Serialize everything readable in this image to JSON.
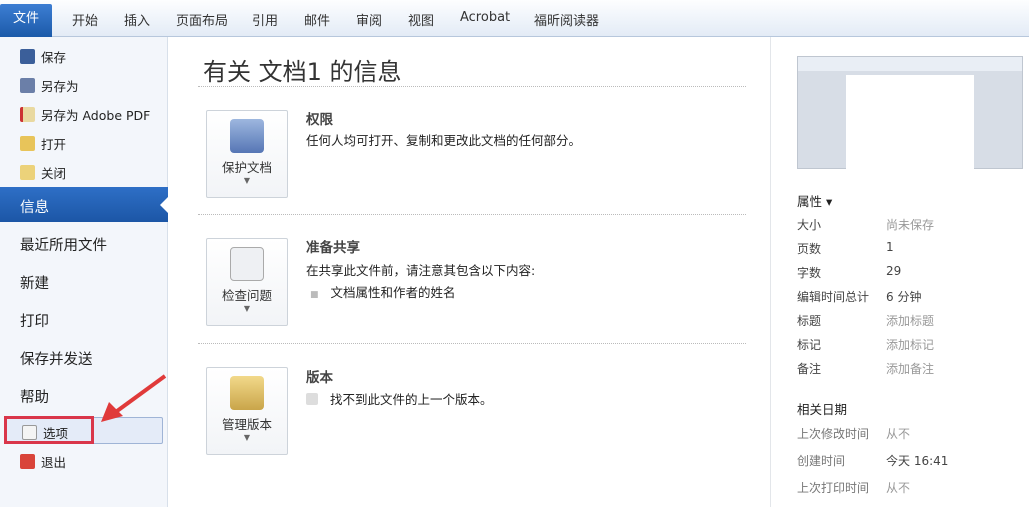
{
  "tabs": [
    "文件",
    "开始",
    "插入",
    "页面布局",
    "引用",
    "邮件",
    "审阅",
    "视图",
    "Acrobat",
    "福昕阅读器"
  ],
  "sidebar": {
    "small": [
      "保存",
      "另存为",
      "另存为 Adobe PDF",
      "打开",
      "关闭"
    ],
    "selected": "信息",
    "big": [
      "最近所用文件",
      "新建",
      "打印",
      "保存并发送",
      "帮助"
    ],
    "options": "选项",
    "exit": "退出"
  },
  "main": {
    "title": "有关 文档1 的信息",
    "sections": [
      {
        "button": "保护文档",
        "heading": "权限",
        "desc": "任何人均可打开、复制和更改此文档的任何部分。"
      },
      {
        "button": "检查问题",
        "heading": "准备共享",
        "desc": "在共享此文件前，请注意其包含以下内容:",
        "bullet": "文档属性和作者的姓名"
      },
      {
        "button": "管理版本",
        "heading": "版本",
        "desc": "找不到此文件的上一个版本。"
      }
    ]
  },
  "props": {
    "heading": "属性 ▾",
    "rows": [
      [
        "大小",
        "尚未保存"
      ],
      [
        "页数",
        "1"
      ],
      [
        "字数",
        "29"
      ],
      [
        "编辑时间总计",
        "6 分钟"
      ],
      [
        "标题",
        "添加标题"
      ],
      [
        "标记",
        "添加标记"
      ],
      [
        "备注",
        "添加备注"
      ]
    ],
    "dates_heading": "相关日期",
    "dates": [
      [
        "上次修改时间",
        "从不"
      ],
      [
        "创建时间",
        "今天 16:41"
      ],
      [
        "上次打印时间",
        "从不"
      ]
    ]
  }
}
